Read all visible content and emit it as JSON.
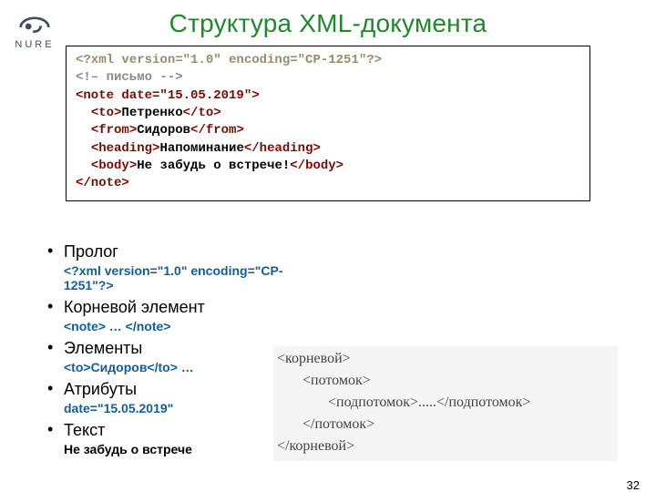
{
  "logo": {
    "text": "NURE"
  },
  "title": "Структура XML-документа",
  "code": {
    "l1": "<?xml version=\"1.0\" encoding=\"CP-1251\"?>",
    "l2": "<!– письмо -->",
    "l3a": "<note date=\"15.05.2019\">",
    "l4_open": "<to>",
    "l4_txt": "Петренко",
    "l4_close": "</to>",
    "l5_open": "<from>",
    "l5_txt": "Сидоров",
    "l5_close": "</from>",
    "l6_open": "<heading>",
    "l6_txt": "Напоминание",
    "l6_close": "</heading>",
    "l7_open": "<body>",
    "l7_txt": "Не забудь о встрече!",
    "l7_close": "</body>",
    "l8": "</note>"
  },
  "bullets": {
    "b1": {
      "head": "Пролог",
      "sub": "<?xml version=\"1.0\" encoding=\"CP-1251\"?>"
    },
    "b2": {
      "head": " Корневой элемент",
      "sub": "<note> … </note>"
    },
    "b3": {
      "head": "Элементы",
      "sub": "<to>Сидоров</to> …"
    },
    "b4": {
      "head": "Атрибуты",
      "sub": "date=\"15.05.2019\""
    },
    "b5": {
      "head": "Текст",
      "sub": "Не забудь о встрече"
    }
  },
  "tree": {
    "l1": "<корневой>",
    "l2": "       <потомок>",
    "l3": "              <подпотомок>.....</подпотомок>",
    "l4": "       </потомок>",
    "l5": "</корневой>"
  },
  "page_number": "32"
}
